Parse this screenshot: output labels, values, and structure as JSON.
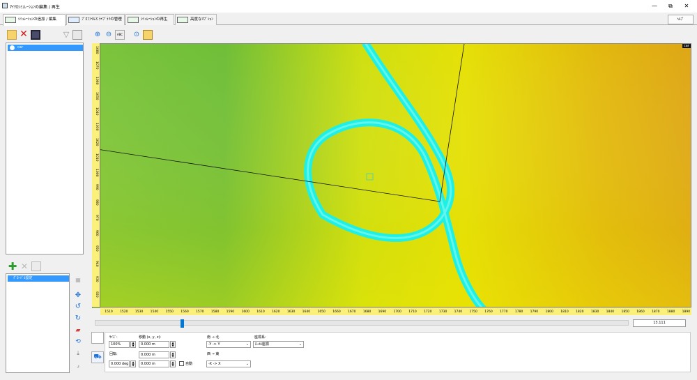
{
  "window": {
    "title": "ﾏｲｸﾛｼﾐｭﾚｰｼｮﾝの編集 / 再生",
    "minimize": "—",
    "restore": "⧉",
    "close": "✕"
  },
  "tabs": [
    {
      "label": "ｼﾐｭﾚｰｼｮﾝの追加 / 編集",
      "active": true
    },
    {
      "label": "ﾌﾟﾛﾌｧｲﾙとﾗｲﾌﾞﾗﾘの管理",
      "active": false
    },
    {
      "label": "ｼﾐｭﾚｰｼｮﾝの再生",
      "active": false
    },
    {
      "label": "高度なｵﾌﾟｼｮﾝ",
      "active": false
    }
  ],
  "help_label": "ﾍﾙﾌﾟ",
  "tree": {
    "node_label": "car"
  },
  "settings": {
    "node_label": "ｸﾞﾛｰﾊﾞﾙ設定"
  },
  "canvas": {
    "object_label": "car",
    "colors": {
      "road": "#1ff0e6",
      "trace": "#111111"
    },
    "x_ticks": [
      "1510",
      "1520",
      "1530",
      "1540",
      "1550",
      "1560",
      "1570",
      "1580",
      "1590",
      "1600",
      "1610",
      "1620",
      "1630",
      "1640",
      "1650",
      "1660",
      "1670",
      "1680",
      "1690",
      "1700",
      "1710",
      "1720",
      "1730",
      "1740",
      "1750",
      "1760",
      "1770",
      "1780",
      "1790",
      "1800",
      "1810",
      "1820",
      "1830",
      "1840",
      "1850",
      "1860",
      "1870",
      "1880",
      "1890"
    ],
    "y_ticks": [
      "1080",
      "1070",
      "1060",
      "1050",
      "1040",
      "1030",
      "1020",
      "1010",
      "1000",
      "990",
      "980",
      "970",
      "960",
      "950",
      "940",
      "930",
      "920"
    ]
  },
  "timeline": {
    "frame": "13.111",
    "position": 0.16
  },
  "props": {
    "size_label": "ｻｲｽﾞ:",
    "size_value": "100%",
    "move_label": "移動 (x, y, z):",
    "move_x": "0.000 m",
    "move_y": "0.000 m",
    "move_z": "0.000 m",
    "rotate_label": "回転:",
    "rotate_value": "0.000 deg",
    "auto_label": "自動",
    "ns_label": "南 → 北",
    "ns_value": "-Y -> Y",
    "we_label": "西 → 東",
    "we_value": "-X -> X",
    "coord_label": "座標系:",
    "coord_value": "ﾛｰｶﾙ座標"
  }
}
